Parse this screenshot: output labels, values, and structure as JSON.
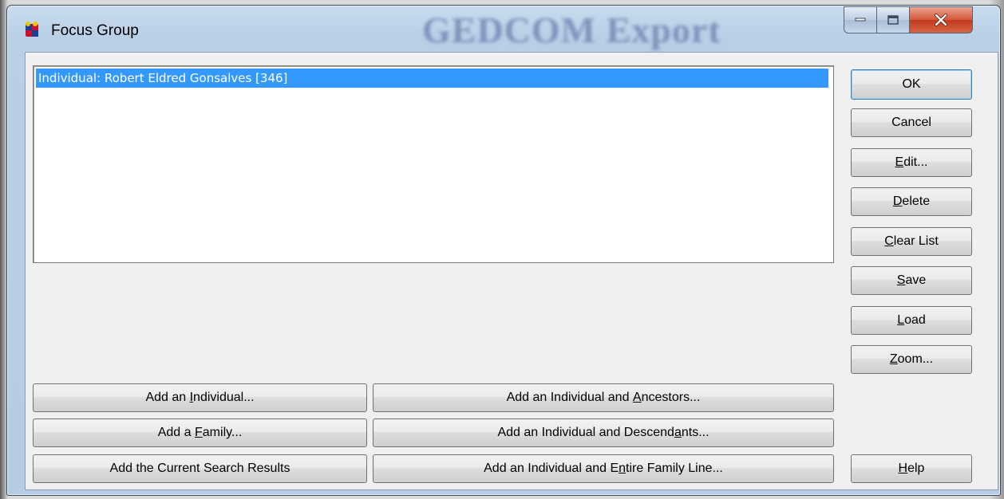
{
  "window": {
    "title": "Focus Group",
    "background_text": "GEDCOM Export",
    "controls": [
      "minimize-icon",
      "maximize-icon",
      "close-icon"
    ]
  },
  "list": {
    "items": [
      "Individual: Robert Eldred Gonsalves [346]"
    ],
    "selected_index": 0
  },
  "side_buttons": [
    {
      "pre": "",
      "key": "",
      "post": "OK"
    },
    {
      "pre": "",
      "key": "",
      "post": "Cancel"
    },
    {
      "pre": "",
      "key": "E",
      "post": "dit..."
    },
    {
      "pre": "",
      "key": "D",
      "post": "elete"
    },
    {
      "pre": "",
      "key": "C",
      "post": "lear List"
    },
    {
      "pre": "",
      "key": "S",
      "post": "ave"
    },
    {
      "pre": "",
      "key": "L",
      "post": "oad"
    },
    {
      "pre": "",
      "key": "Z",
      "post": "oom..."
    },
    {
      "pre": "",
      "key": "H",
      "post": "elp"
    }
  ],
  "add_buttons": [
    {
      "pre": "Add an ",
      "key": "I",
      "post": "ndividual..."
    },
    {
      "pre": "Add an Individual and ",
      "key": "A",
      "post": "ncestors..."
    },
    {
      "pre": "Add a ",
      "key": "F",
      "post": "amily..."
    },
    {
      "pre": "Add an Individual and Descend",
      "key": "a",
      "post": "nts..."
    },
    {
      "pre": "Add the Current Search Results",
      "key": "",
      "post": ""
    },
    {
      "pre": "Add an Individual and E",
      "key": "n",
      "post": "tire Family Line..."
    }
  ],
  "colors": {
    "selection": "#3399ff",
    "default_button_border": "#3c7fb1",
    "close_button": "#c7432b"
  }
}
